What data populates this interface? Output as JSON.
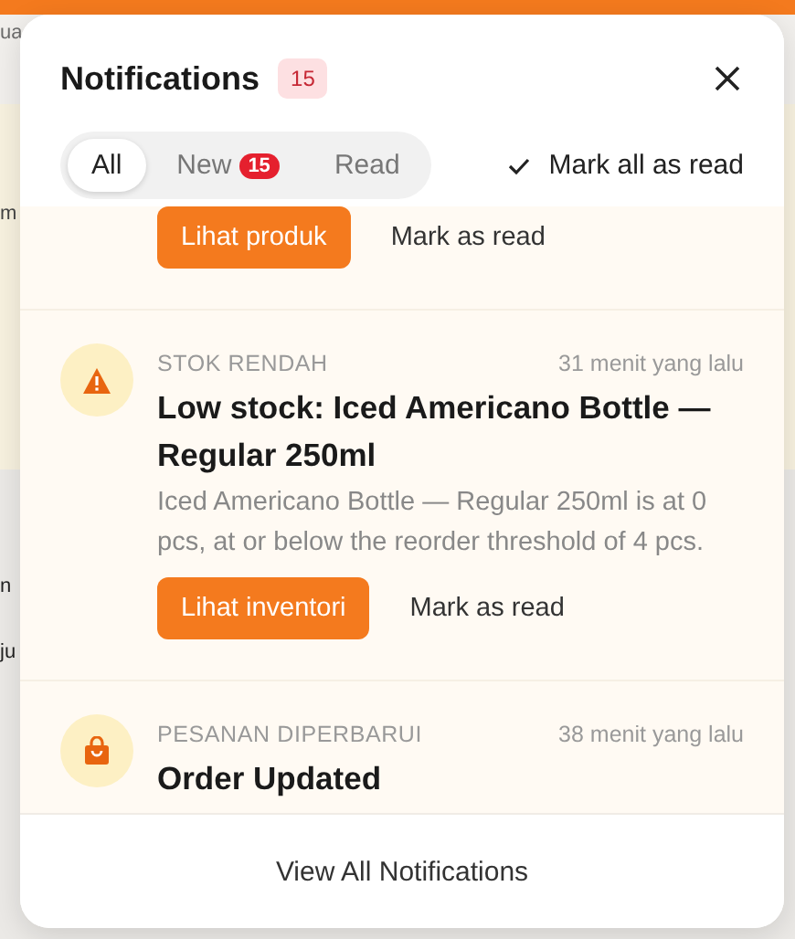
{
  "background_page": {
    "texts": [
      "ua",
      "m",
      "n",
      "ju"
    ]
  },
  "notifications_panel": {
    "title": "Notifications",
    "count": "15",
    "tabs": [
      {
        "label": "All",
        "selected": true
      },
      {
        "label": "New",
        "badge": "15",
        "selected": false
      },
      {
        "label": "Read",
        "selected": false
      }
    ],
    "mark_all": "Mark all as read",
    "items": [
      {
        "action": "Lihat produk",
        "mark_read": "Mark as read"
      },
      {
        "kind": "warning",
        "category": "STOK RENDAH",
        "time": "31 menit yang lalu",
        "title": "Low stock: Iced Americano Bottle — Regular 250ml",
        "body": "Iced Americano Bottle — Regular 250ml is at 0 pcs, at or below the reorder threshold of 4 pcs.",
        "action": "Lihat inventori",
        "mark_read": "Mark as read"
      },
      {
        "kind": "order",
        "category": "PESANAN DIPERBARUI",
        "time": "38 menit yang lalu",
        "title": "Order Updated"
      }
    ],
    "footer": "View All Notifications"
  }
}
